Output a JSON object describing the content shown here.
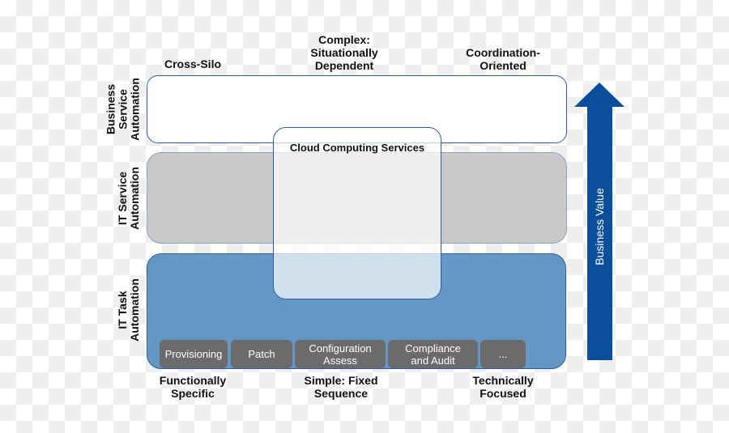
{
  "top_labels": {
    "left": "Cross-Silo",
    "center": [
      "Complex:",
      "Situationally",
      "Dependent"
    ],
    "right": [
      "Coordination-",
      "Oriented"
    ]
  },
  "layers": {
    "business": [
      "Business",
      "Service",
      "Automation"
    ],
    "it_service": [
      "IT Service",
      "Automation"
    ],
    "it_task": [
      "IT Task",
      "Automation"
    ]
  },
  "cloud": {
    "title": "Cloud Computing Services"
  },
  "tasks": [
    {
      "label": [
        "Provisioning"
      ]
    },
    {
      "label": [
        "Patch"
      ]
    },
    {
      "label": [
        "Configuration",
        "Assess"
      ]
    },
    {
      "label": [
        "Compliance",
        "and Audit"
      ]
    },
    {
      "label": [
        "..."
      ]
    }
  ],
  "bottom_labels": {
    "left": [
      "Functionally",
      "Specific"
    ],
    "center": [
      "Simple: Fixed",
      "Sequence"
    ],
    "right": [
      "Technically",
      "Focused"
    ]
  },
  "arrow": {
    "label": "Business Value",
    "color": "#0b4f9c"
  },
  "colors": {
    "border": "#2a5fa5",
    "it_service_fill": "#c9c9c9",
    "it_task_fill": "#6597c4",
    "chip_fill": "#6b6b6b"
  }
}
